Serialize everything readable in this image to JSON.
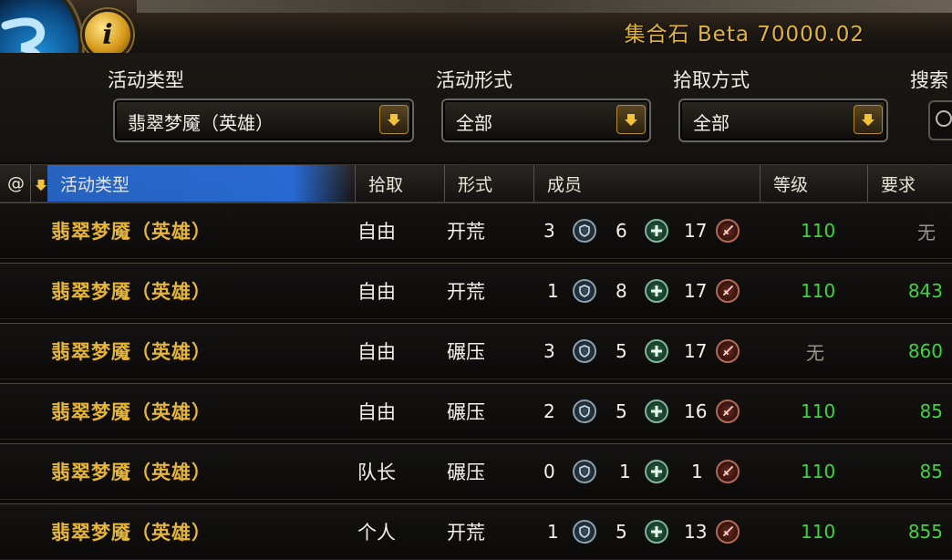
{
  "app": {
    "title": "集合石 Beta 70000.02"
  },
  "filters": [
    {
      "label": "活动类型",
      "value": "翡翠梦魇（英雄）"
    },
    {
      "label": "活动形式",
      "value": "全部"
    },
    {
      "label": "拾取方式",
      "value": "全部"
    }
  ],
  "search": {
    "label": "搜索"
  },
  "columns": {
    "at": "@",
    "activity": "活动类型",
    "loot": "拾取",
    "form": "形式",
    "members": "成员",
    "level": "等级",
    "requirement": "要求"
  },
  "rows": [
    {
      "activity": "翡翠梦魇（英雄）",
      "loot": "自由",
      "form": "开荒",
      "tank": "3",
      "healer": "6",
      "dps": "17",
      "level": "110",
      "requirement": "无"
    },
    {
      "activity": "翡翠梦魇（英雄）",
      "loot": "自由",
      "form": "开荒",
      "tank": "1",
      "healer": "8",
      "dps": "17",
      "level": "110",
      "requirement": "843"
    },
    {
      "activity": "翡翠梦魇（英雄）",
      "loot": "自由",
      "form": "碾压",
      "tank": "3",
      "healer": "5",
      "dps": "17",
      "level": "无",
      "requirement": "860"
    },
    {
      "activity": "翡翠梦魇（英雄）",
      "loot": "自由",
      "form": "碾压",
      "tank": "2",
      "healer": "5",
      "dps": "16",
      "level": "110",
      "requirement": "85"
    },
    {
      "activity": "翡翠梦魇（英雄）",
      "loot": "队长",
      "form": "碾压",
      "tank": "0",
      "healer": "1",
      "dps": "1",
      "level": "110",
      "requirement": "85"
    },
    {
      "activity": "翡翠梦魇（英雄）",
      "loot": "个人",
      "form": "开荒",
      "tank": "1",
      "healer": "5",
      "dps": "13",
      "level": "110",
      "requirement": "855"
    }
  ],
  "icons": {
    "logo": "addon-logo-icon",
    "info": "info-icon",
    "dropdown": "chevron-down-icon",
    "search": "search-icon",
    "sort": "sort-arrow-icon",
    "tank": "tank-shield-icon",
    "healer": "healer-plus-icon",
    "dps": "dps-sword-icon"
  },
  "colors": {
    "activity_text": "#e6b536",
    "title_text": "#e2b53a",
    "level_ok": "#3fd43f",
    "none_text": "#9a968c",
    "sorted_header": "#2c6edc"
  }
}
